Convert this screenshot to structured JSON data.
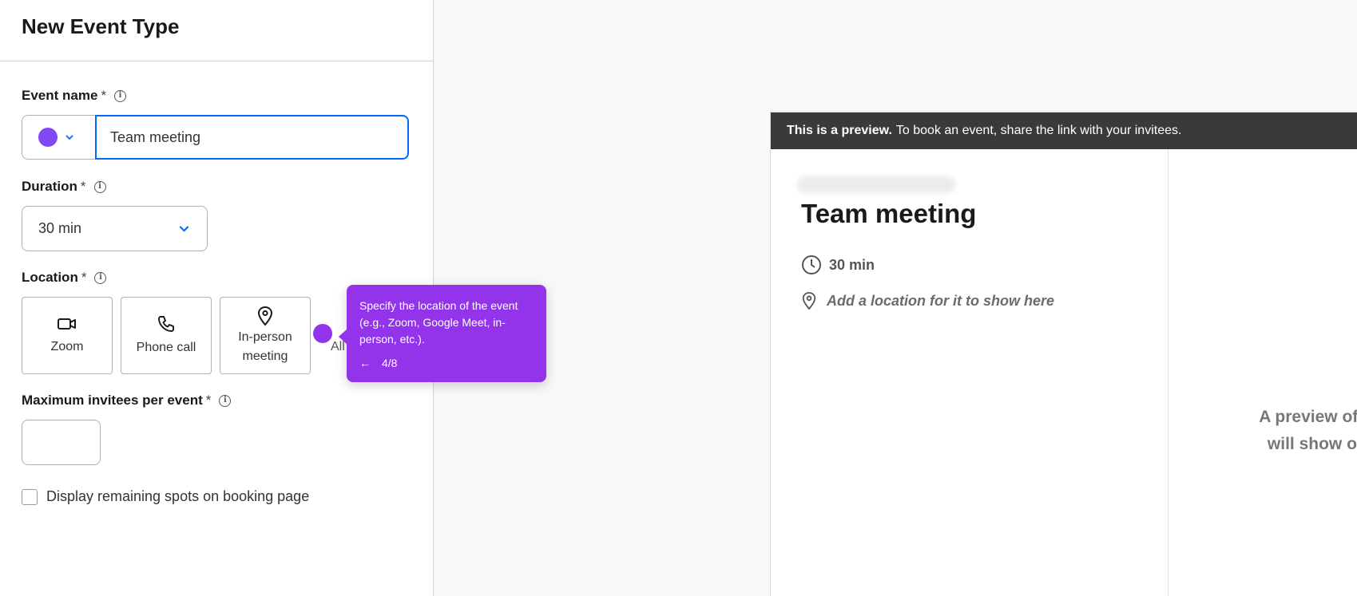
{
  "panel": {
    "title": "New Event Type"
  },
  "event_name": {
    "label": "Event name",
    "required_mark": "*",
    "value": "Team meeting",
    "color": "#8247f5"
  },
  "duration": {
    "label": "Duration",
    "required_mark": "*",
    "value": "30 min"
  },
  "location": {
    "label": "Location",
    "required_mark": "*",
    "options": [
      {
        "label": "Zoom",
        "icon": "video-camera-icon"
      },
      {
        "label": "Phone call",
        "icon": "phone-icon"
      },
      {
        "label": "In-person meeting",
        "icon": "map-pin-icon"
      }
    ],
    "all_label": "All"
  },
  "max_invitees": {
    "label": "Maximum invitees per event",
    "required_mark": "*",
    "value": ""
  },
  "display_spots": {
    "label": "Display remaining spots on booking page",
    "checked": false
  },
  "tooltip": {
    "text": "Specify the location of the event (e.g., Zoom, Google Meet, in-person, etc.).",
    "back_arrow": "←",
    "step": "4/8",
    "color": "#9333ea"
  },
  "preview": {
    "banner_bold": "This is a preview.",
    "banner_text": "To book an event, share the link with your invitees.",
    "title": "Team meeting",
    "duration": "30 min",
    "location_placeholder": "Add a location for it to show here",
    "right_text_line1": "A preview of y",
    "right_text_line2": "will show or"
  }
}
